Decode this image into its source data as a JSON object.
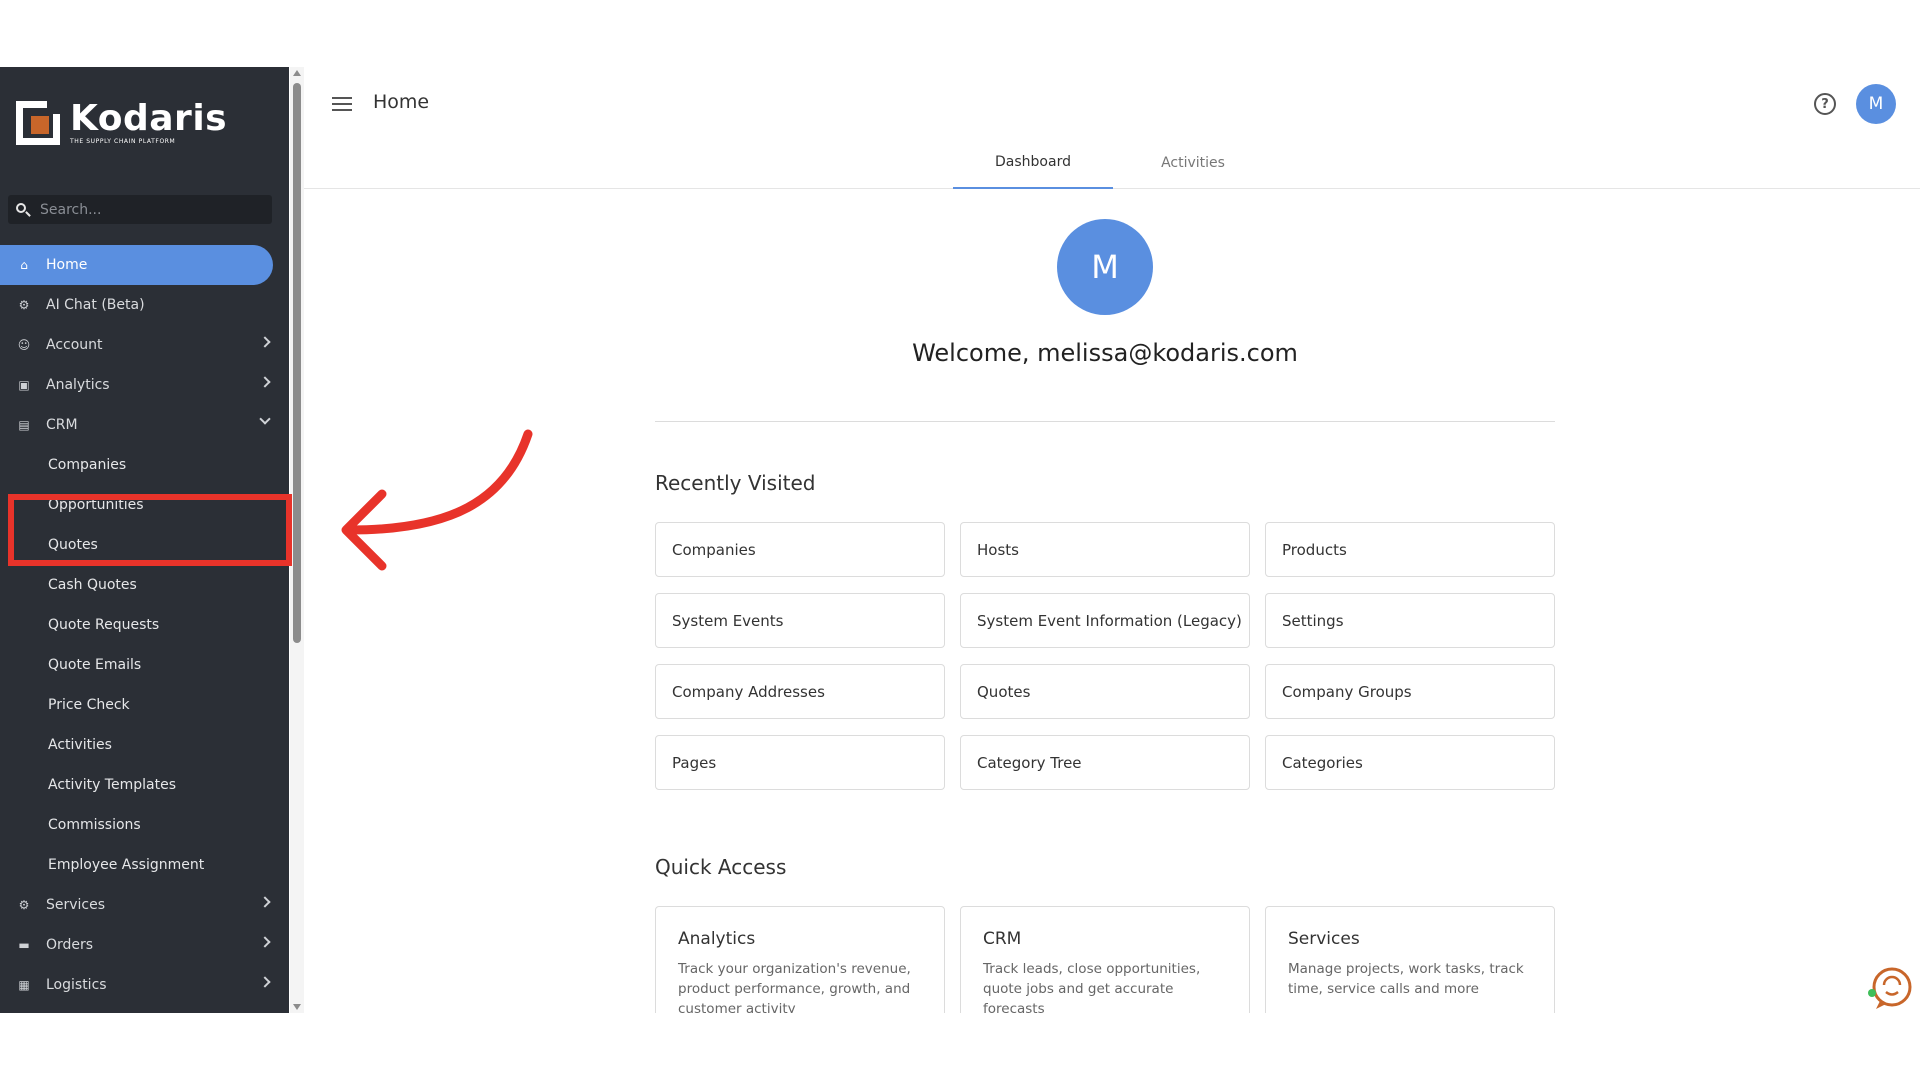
{
  "app": {
    "logo_name": "Kodaris",
    "logo_tagline": "THE SUPPLY CHAIN PLATFORM"
  },
  "sidebar": {
    "search_placeholder": "Search...",
    "items": [
      {
        "label": "Home",
        "icon": "home-icon",
        "active": true
      },
      {
        "label": "AI Chat (Beta)",
        "icon": "robot-icon"
      },
      {
        "label": "Account",
        "icon": "person-icon",
        "chevron": "right"
      },
      {
        "label": "Analytics",
        "icon": "analytics-icon",
        "chevron": "right"
      },
      {
        "label": "CRM",
        "icon": "crm-icon",
        "chevron": "down"
      },
      {
        "label": "Companies"
      },
      {
        "label": "Opportunities"
      },
      {
        "label": "Quotes"
      },
      {
        "label": "Cash Quotes"
      },
      {
        "label": "Quote Requests"
      },
      {
        "label": "Quote Emails"
      },
      {
        "label": "Price Check"
      },
      {
        "label": "Activities"
      },
      {
        "label": "Activity Templates"
      },
      {
        "label": "Commissions"
      },
      {
        "label": "Employee Assignment"
      },
      {
        "label": "Services",
        "icon": "services-icon",
        "chevron": "right"
      },
      {
        "label": "Orders",
        "icon": "truck-icon",
        "chevron": "right"
      },
      {
        "label": "Logistics",
        "icon": "logistics-icon",
        "chevron": "right"
      }
    ]
  },
  "header": {
    "title": "Home",
    "avatar_initial": "M",
    "help_glyph": "?",
    "tabs": [
      "Dashboard",
      "Activities"
    ]
  },
  "main": {
    "avatar_initial": "M",
    "welcome": "Welcome, melissa@kodaris.com",
    "recently_visited_title": "Recently Visited",
    "recently_visited": [
      "Companies",
      "Hosts",
      "Products",
      "System Events",
      "System Event Information (Legacy)",
      "Settings",
      "Company Addresses",
      "Quotes",
      "Company Groups",
      "Pages",
      "Category Tree",
      "Categories"
    ],
    "quick_access_title": "Quick Access",
    "quick_access": [
      {
        "title": "Analytics",
        "desc": "Track your organization's revenue, product performance, growth, and customer activity"
      },
      {
        "title": "CRM",
        "desc": "Track leads, close opportunities, quote jobs and get accurate forecasts"
      },
      {
        "title": "Services",
        "desc": "Manage projects, work tasks, track time, service calls and more"
      }
    ]
  },
  "colors": {
    "sidebar_bg": "#2b2f36",
    "accent": "#5a8fe0",
    "annotation": "#e8332a",
    "logo_orange": "#c8662a"
  }
}
